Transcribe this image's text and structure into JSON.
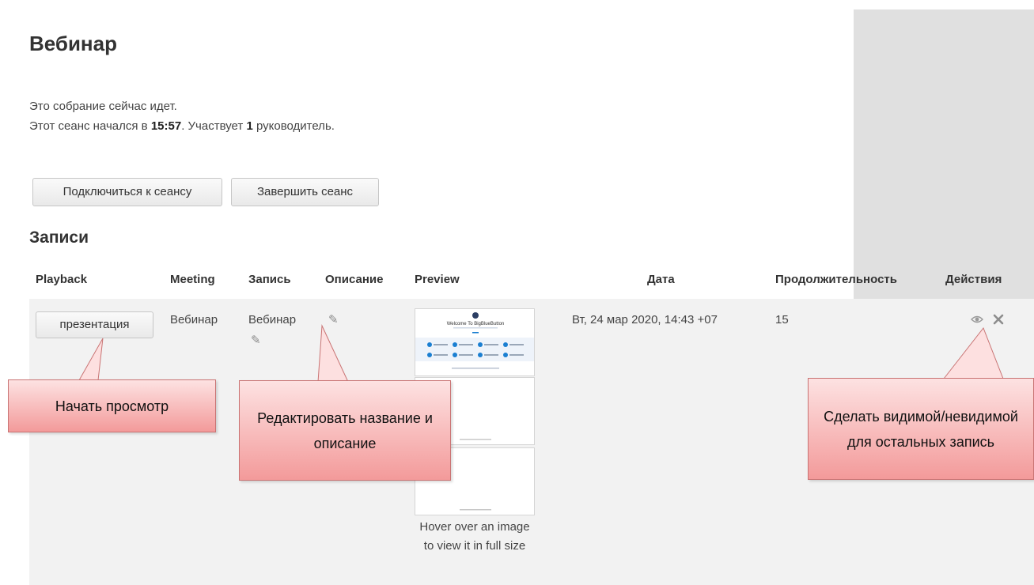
{
  "page_title": "Вебинар",
  "status": {
    "line1": "Это собрание сейчас идет.",
    "line2_prefix": "Этот сеанс начался в ",
    "start_time": "15:57",
    "line2_mid": ". Участвует ",
    "moderators": "1",
    "line2_suffix": " руководитель."
  },
  "buttons": {
    "join": "Подключиться к сеансу",
    "end": "Завершить сеанс"
  },
  "recordings_title": "Записи",
  "columns": [
    "Playback",
    "Meeting",
    "Запись",
    "Описание",
    "Preview",
    "Дата",
    "Продолжительность",
    "Действия"
  ],
  "row": {
    "playback": "презентация",
    "meeting": "Вебинар",
    "recording": "Вебинар",
    "date": "Вт, 24 мар 2020, 14:43 +07",
    "duration": "15",
    "preview_hint": "Hover over an image to view it in full size"
  },
  "preview_slide": {
    "title": "Welcome To BigBlueButton"
  },
  "callouts": {
    "play": "Начать просмотр",
    "edit": "Редактировать название и описание",
    "visibility": "Сделать видимой/невидимой для остальных запись"
  },
  "icons": {
    "edit": "pencil-icon",
    "visibility": "eye-icon",
    "delete": "close-icon"
  },
  "colors": {
    "callout": "#f39a9a",
    "sidebar": "#e0e0e0",
    "row": "#f2f2f2"
  }
}
